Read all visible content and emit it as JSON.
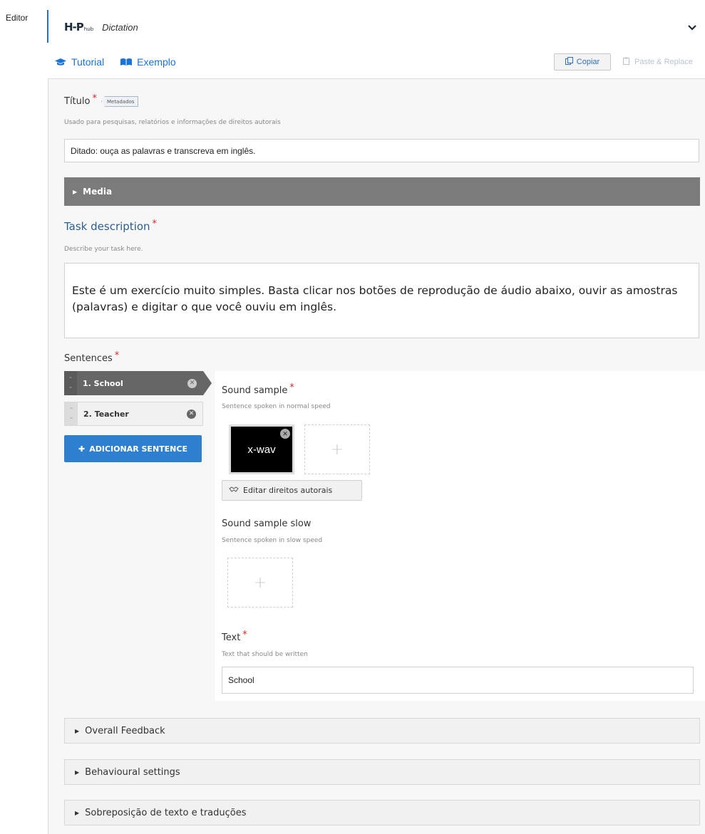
{
  "editor_label": "Editor",
  "header": {
    "logo_main": "H-P",
    "logo_sub": "hub",
    "library_name": "Dictation"
  },
  "links": {
    "tutorial": "Tutorial",
    "example": "Exemplo"
  },
  "clipboard": {
    "copy": "Copiar",
    "paste_replace": "Paste & Replace"
  },
  "title_field": {
    "label": "Título",
    "required_mark": "*",
    "metadata_tag": "Metadados",
    "description": "Usado para pesquisas, relatórios e informações de direitos autorais",
    "value": "Ditado: ouça as palavras e transcreva em inglês."
  },
  "media_section": {
    "label": "Media"
  },
  "task_description": {
    "label": "Task description",
    "required_mark": "*",
    "description": "Describe your task here.",
    "value": "Este é um exercício muito simples. Basta clicar nos botões de reprodução de áudio abaixo, ouvir as amostras (palavras) e digitar o que você ouviu em inglês."
  },
  "sentences": {
    "label": "Sentences",
    "required_mark": "*",
    "items": [
      {
        "label": "1. School",
        "active": true
      },
      {
        "label": "2. Teacher",
        "active": false
      }
    ],
    "add_button": "ADICIONAR SENTENCE"
  },
  "sentence_panel": {
    "sound_sample": {
      "label": "Sound sample",
      "required_mark": "*",
      "description": "Sentence spoken in normal speed",
      "file_type": "x-wav",
      "add_symbol": "+",
      "copyright_button": "Editar direitos autorais"
    },
    "sound_sample_slow": {
      "label": "Sound sample slow",
      "description": "Sentence spoken in slow speed",
      "add_symbol": "+"
    },
    "text": {
      "label": "Text",
      "required_mark": "*",
      "description": "Text that should be written",
      "value": "School"
    }
  },
  "accordions": [
    {
      "label": "Overall Feedback"
    },
    {
      "label": "Behavioural settings"
    },
    {
      "label": "Sobreposição de texto e traduções"
    }
  ],
  "colors": {
    "accent_blue": "#1a73d9",
    "button_blue": "#2f7fd0",
    "required_red": "#d9262a",
    "media_bar": "#7b7b7b"
  }
}
